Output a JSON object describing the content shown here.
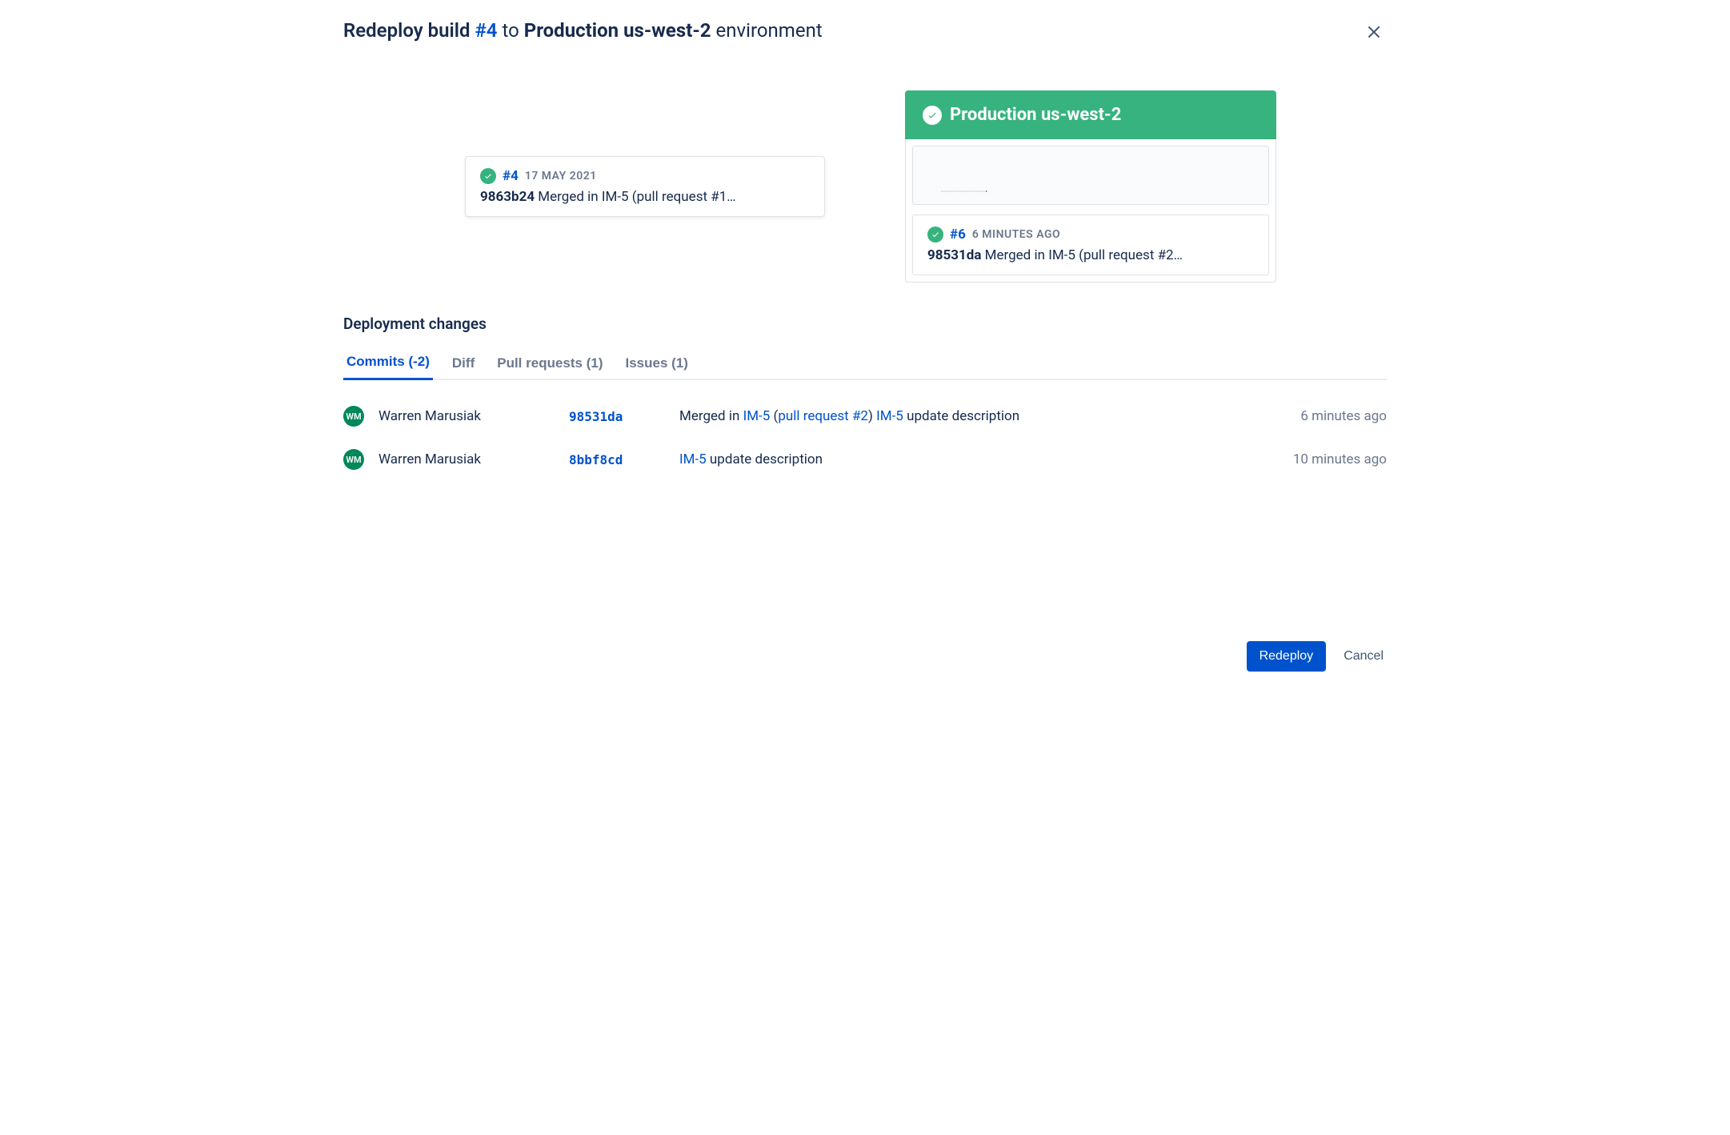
{
  "header": {
    "prefix": "Redeploy build ",
    "build": "#4",
    "to": " to ",
    "env": "Production us-west-2",
    "suffix": " environment"
  },
  "source_card": {
    "build": "#4",
    "date": "17 MAY 2021",
    "hash": "9863b24",
    "message": " Merged in IM-5 (pull request #1…"
  },
  "env_column": {
    "title": "Production us-west-2",
    "current_card": {
      "build": "#6",
      "date": "6 MINUTES AGO",
      "hash": "98531da",
      "message": " Merged in IM-5 (pull request #2…"
    }
  },
  "changes": {
    "title": "Deployment changes",
    "tabs": [
      {
        "label": "Commits (-2)",
        "active": true
      },
      {
        "label": "Diff",
        "active": false
      },
      {
        "label": "Pull requests (1)",
        "active": false
      },
      {
        "label": "Issues (1)",
        "active": false
      }
    ],
    "commits": [
      {
        "avatar": "WM",
        "author": "Warren Marusiak",
        "hash": "98531da",
        "msg_prefix": "Merged in ",
        "link1": "IM-5",
        "msg_mid1": " (",
        "link2": "pull request #2",
        "msg_mid2": ") ",
        "link3": "IM-5",
        "msg_suffix": " update description",
        "time": "6 minutes ago"
      },
      {
        "avatar": "WM",
        "author": "Warren Marusiak",
        "hash": "8bbf8cd",
        "msg_prefix": "",
        "link1": "IM-5",
        "msg_mid1": "",
        "link2": "",
        "msg_mid2": "",
        "link3": "",
        "msg_suffix": " update description",
        "time": "10 minutes ago"
      }
    ]
  },
  "footer": {
    "redeploy": "Redeploy",
    "cancel": "Cancel"
  }
}
